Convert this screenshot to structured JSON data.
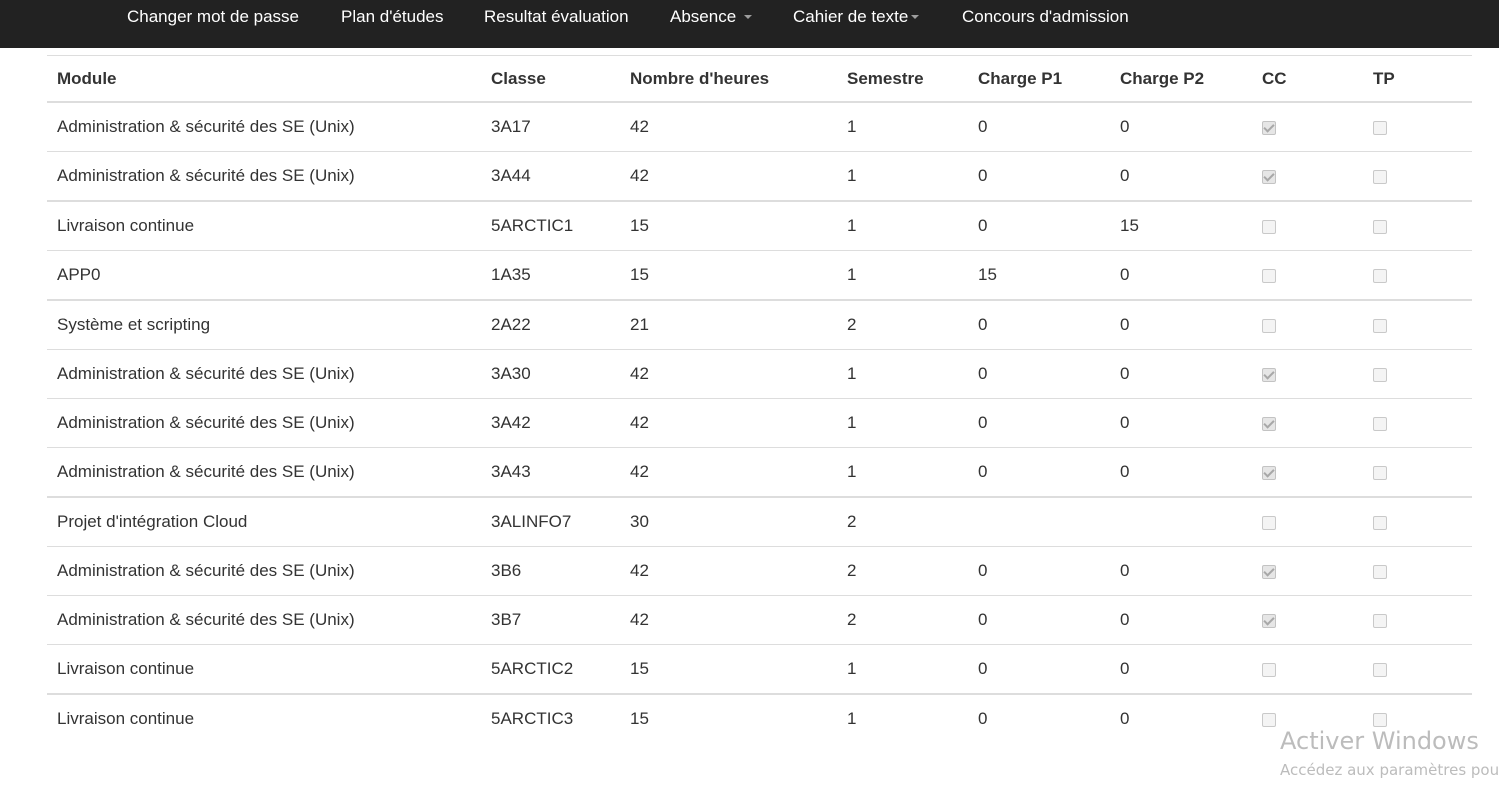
{
  "navbar": {
    "items": [
      {
        "label": "Changer mot de passe",
        "dropdown": false
      },
      {
        "label": "Plan d'études",
        "dropdown": false
      },
      {
        "label": "Resultat évaluation",
        "dropdown": false
      },
      {
        "label": "Absence",
        "dropdown": true
      },
      {
        "label": "Cahier de texte",
        "dropdown": true
      },
      {
        "label": "Concours d'admission",
        "dropdown": false
      }
    ]
  },
  "table": {
    "headers": [
      "Module",
      "Classe",
      "Nombre d'heures",
      "Semestre",
      "Charge P1",
      "Charge P2",
      "CC",
      "TP"
    ],
    "rows": [
      {
        "module": "Administration & sécurité des SE (Unix)",
        "classe": "3A17",
        "heures": "42",
        "semestre": "1",
        "p1": "0",
        "p2": "0",
        "cc": true,
        "tp": false
      },
      {
        "module": "Administration & sécurité des SE (Unix)",
        "classe": "3A44",
        "heures": "42",
        "semestre": "1",
        "p1": "0",
        "p2": "0",
        "cc": true,
        "tp": false
      },
      {
        "module": "Livraison continue",
        "classe": "5ARCTIC1",
        "heures": "15",
        "semestre": "1",
        "p1": "0",
        "p2": "15",
        "cc": false,
        "tp": false
      },
      {
        "module": "APP0",
        "classe": "1A35",
        "heures": "15",
        "semestre": "1",
        "p1": "15",
        "p2": "0",
        "cc": false,
        "tp": false
      },
      {
        "module": "Système et scripting",
        "classe": "2A22",
        "heures": "21",
        "semestre": "2",
        "p1": "0",
        "p2": "0",
        "cc": false,
        "tp": false
      },
      {
        "module": "Administration & sécurité des SE (Unix)",
        "classe": "3A30",
        "heures": "42",
        "semestre": "1",
        "p1": "0",
        "p2": "0",
        "cc": true,
        "tp": false
      },
      {
        "module": "Administration & sécurité des SE (Unix)",
        "classe": "3A42",
        "heures": "42",
        "semestre": "1",
        "p1": "0",
        "p2": "0",
        "cc": true,
        "tp": false
      },
      {
        "module": "Administration & sécurité des SE (Unix)",
        "classe": "3A43",
        "heures": "42",
        "semestre": "1",
        "p1": "0",
        "p2": "0",
        "cc": true,
        "tp": false
      },
      {
        "module": "Projet d'intégration Cloud",
        "classe": "3ALINFO7",
        "heures": "30",
        "semestre": "2",
        "p1": "",
        "p2": "",
        "cc": false,
        "tp": false
      },
      {
        "module": "Administration & sécurité des SE (Unix)",
        "classe": "3B6",
        "heures": "42",
        "semestre": "2",
        "p1": "0",
        "p2": "0",
        "cc": true,
        "tp": false
      },
      {
        "module": "Administration & sécurité des SE (Unix)",
        "classe": "3B7",
        "heures": "42",
        "semestre": "2",
        "p1": "0",
        "p2": "0",
        "cc": true,
        "tp": false
      },
      {
        "module": "Livraison continue",
        "classe": "5ARCTIC2",
        "heures": "15",
        "semestre": "1",
        "p1": "0",
        "p2": "0",
        "cc": false,
        "tp": false
      },
      {
        "module": "Livraison continue",
        "classe": "5ARCTIC3",
        "heures": "15",
        "semestre": "1",
        "p1": "0",
        "p2": "0",
        "cc": false,
        "tp": false
      }
    ]
  },
  "watermark": {
    "title": "Activer Windows",
    "subtitle": "Accédez aux paramètres pour activer Windows."
  }
}
